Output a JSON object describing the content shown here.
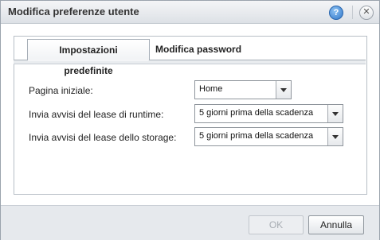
{
  "dialog": {
    "title": "Modifica preferenze utente",
    "help_glyph": "?",
    "close_glyph": "✕"
  },
  "tabs": [
    {
      "label": "Impostazioni predefinite",
      "active": true
    },
    {
      "label": "Modifica password",
      "active": false
    }
  ],
  "form": {
    "start_page": {
      "label": "Pagina iniziale:",
      "value": "Home"
    },
    "runtime_lease": {
      "label": "Invia avvisi del lease di runtime:",
      "value": "5 giorni prima della scadenza"
    },
    "storage_lease": {
      "label": "Invia avvisi del lease dello storage:",
      "value": "5 giorni prima della scadenza"
    }
  },
  "buttons": {
    "ok": "OK",
    "cancel": "Annulla"
  },
  "icons": {
    "help": "help-icon",
    "close": "close-icon",
    "dropdown": "chevron-down-icon"
  }
}
